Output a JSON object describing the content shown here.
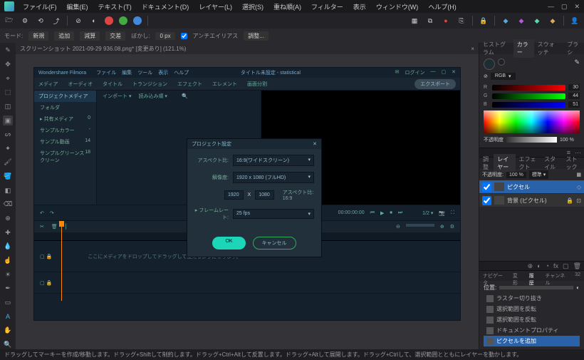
{
  "menu": {
    "file": "ファイル(F)",
    "edit": "編集(E)",
    "text": "テキスト(T)",
    "document": "ドキュメント(D)",
    "layer": "レイヤー(L)",
    "select": "選択(S)",
    "arrange": "重ね順(A)",
    "filter": "フィルター",
    "view": "表示",
    "window": "ウィンドウ(W)",
    "help": "ヘルプ(H)"
  },
  "toolbar2": {
    "mode": "モード:",
    "new": "新規",
    "add": "追加",
    "subtract": "減算",
    "intersect": "交差",
    "feather": "ぼかし:",
    "feather_val": "0 px",
    "antialias": "アンチエイリアス",
    "adjust": "調整..."
  },
  "tab": {
    "title": "スクリーンショット 2021-09-29 936.08.png* [変更あり] (121.1%)"
  },
  "embedded": {
    "brand": "Wondershare Filmora",
    "m1": "ファイル",
    "m2": "編集",
    "m3": "ツール",
    "m4": "表示",
    "m5": "ヘルプ",
    "right_label": "タイトル未設定 - statistical",
    "login": "ログイン",
    "tb_media": "メディア",
    "tb_audio": "オーディオ",
    "tb_title": "タイトル",
    "tb_trans": "トランジション",
    "tb_effect": "エフェクト",
    "tb_element": "エレメント",
    "tb_split": "画面分割",
    "export": "エクスポート",
    "side_hd": "プロジェクトメディア",
    "side1": "フォルダ",
    "side2": "共有メディア",
    "side2n": "0",
    "side3": "サンプルカラー",
    "side3n": "-",
    "side4": "サンプル動画",
    "side4n": "14",
    "side5": "サンプルグリーンスクリーン",
    "side5n": "18",
    "import": "インポート ▾",
    "sort": "読み込み順 ▾",
    "ctl_time": "00:00:00:00",
    "track_msg": "ここにメディアをドロップしてドラッグして使えるようになります。"
  },
  "dialog": {
    "title": "プロジェクト設定",
    "lbl_aspect": "アスペクト比:",
    "aspect_val": "16:9(ワイドスクリーン)",
    "lbl_res": "解像度:",
    "res_val": "1920 x 1080 (フルHD)",
    "res_w": "1920",
    "x": "X",
    "res_h": "1080",
    "aspect_note": "アスペクト比: 16:9",
    "lbl_fps": "フレームレート:",
    "fps_val": "25 fps",
    "ok": "OK",
    "cancel": "キャンセル"
  },
  "right": {
    "tab_hist": "ヒストグラム",
    "tab_color": "カラー",
    "tab_swatch": "スウォッチ",
    "tab_brush": "ブラシ",
    "mode_rgb": "RGB",
    "r": "R",
    "r_val": "30",
    "g": "G",
    "g_val": "44",
    "b": "B",
    "b_val": "51",
    "opacity_lbl": "不透明度",
    "opacity_val": "100 %",
    "tab_adj": "調整",
    "tab_layer": "レイヤー",
    "tab_fx": "エフェクト",
    "tab_style": "スタイル",
    "tab_stock": "ストック",
    "lay_opacity": "不透明度:",
    "lay_opacity_val": "100 %",
    "lay_blend": "標準",
    "layer1": "ピクセル",
    "layer2": "背景 (ピクセル)",
    "tab_nav": "ナビゲータ",
    "tab_xform": "変形",
    "tab_hist2": "履歴",
    "tab_chan": "チャンネル",
    "tab_32": "32",
    "pos_lbl": "位置:",
    "hist1": "ラスター切り抜き",
    "hist2": "選択範囲を反転",
    "hist3": "選択範囲を反転",
    "hist4": "ドキュメントプロパティ",
    "hist5": "ピクセルを追加"
  },
  "status": {
    "text": "ドラッグしてマーキーを作成/移動します。ドラッグ+Shiftして制約します。ドラッグ+Ctrl+Altして反置します。ドラッグ+Altして展開します。ドラッグ+Ctrlして、選択範囲とともにレイヤーを動かします。"
  }
}
